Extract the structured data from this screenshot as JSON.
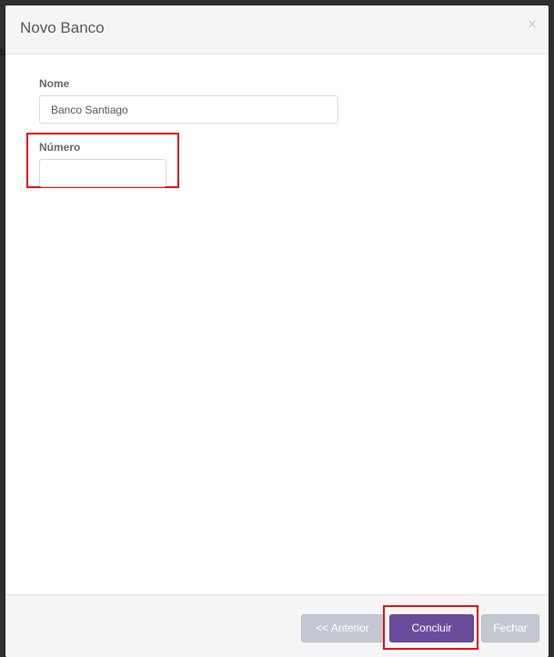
{
  "modal": {
    "title": "Novo Banco",
    "close_glyph": "×"
  },
  "backdrop": {
    "edge_glyph": "b"
  },
  "form": {
    "nome": {
      "label": "Nome",
      "value": "Banco Santiago"
    },
    "numero": {
      "label": "Número",
      "value": ""
    }
  },
  "footer": {
    "anterior_label": "<< Anterior",
    "concluir_label": "Concluir",
    "fechar_label": "Fechar"
  },
  "colors": {
    "primary": "#6a4c9c",
    "disabled": "#c3c8d2",
    "highlight": "#e01010"
  },
  "icons": {
    "close": "close-icon"
  }
}
